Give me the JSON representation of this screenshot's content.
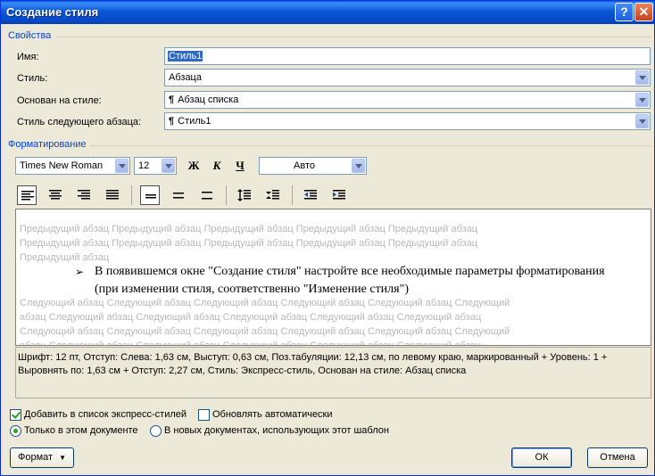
{
  "window": {
    "title": "Создание стиля"
  },
  "properties": {
    "group_title": "Свойства",
    "name_label": "Имя:",
    "name_value": "Стиль1",
    "style_label": "Стиль:",
    "style_value": "Абзаца",
    "based_label": "Основан на стиле:",
    "based_value": "Абзац списка",
    "next_label": "Стиль следующего абзаца:",
    "next_value": "Стиль1"
  },
  "formatting": {
    "group_title": "Форматирование",
    "font_name": "Times New Roman",
    "font_size": "12",
    "bold_label": "Ж",
    "italic_label": "К",
    "underline_label": "Ч",
    "color_value": "Авто"
  },
  "preview": {
    "prev_lines": [
      "Предыдущий абзац Предыдущий абзац Предыдущий абзац Предыдущий абзац Предыдущий абзац",
      "Предыдущий абзац Предыдущий абзац Предыдущий абзац Предыдущий абзац Предыдущий абзац",
      "Предыдущий абзац"
    ],
    "bullet": "➢",
    "main_text": "В появившемся окне \"Создание стиля\" настройте все необходимые параметры форматирования (при изменении стиля, соответственно \"Изменение стиля\")",
    "next_lines": [
      "Следующий абзац Следующий абзац Следующий абзац Следующий абзац Следующий абзац Следующий",
      "абзац Следующий абзац Следующий абзац Следующий абзац Следующий абзац Следующий абзац",
      "Следующий абзац Следующий абзац Следующий абзац Следующий абзац Следующий абзац Следующий",
      "абзац Следующий абзац Следующий абзац Следующий абзац Следующий абзац Следующий абзац"
    ]
  },
  "description": "Шрифт: 12 пт, Отступ: Слева:  1,63 см, Выступ:  0,63 см, Поз.табуляции:  12,13 см, по левому краю, маркированный + Уровень: 1 + Выровнять по:  1,63 см + Отступ:  2,27 см, Стиль: Экспресс-стиль, Основан на стиле: Абзац списка",
  "options": {
    "add_quick_styles": "Добавить в список экспресс-стилей",
    "auto_update": "Обновлять автоматически",
    "only_this_doc": "Только в этом документе",
    "new_docs": "В новых документах, использующих этот шаблон"
  },
  "buttons": {
    "format": "Формат",
    "ok": "ОК",
    "cancel": "Отмена"
  }
}
